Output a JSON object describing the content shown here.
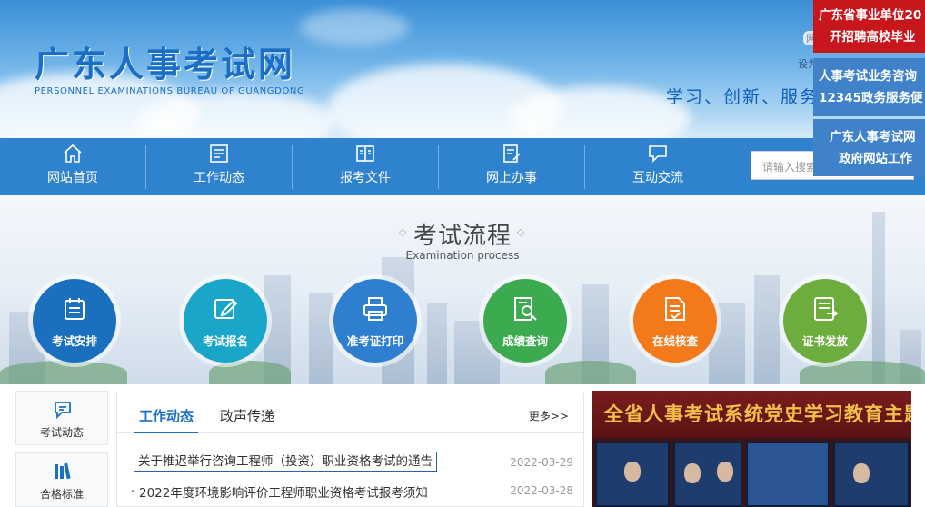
{
  "header": {
    "logo_cn": "广东人事考试网",
    "logo_en": "PERSONNEL EXAMINATIONS BUREAU OF GUANGDONG",
    "slogan": "学习、创新、服务",
    "toplink_a": "网",
    "toplink_b": "设为"
  },
  "nav": {
    "items": [
      {
        "label": "网站首页",
        "icon": "home-icon"
      },
      {
        "label": "工作动态",
        "icon": "news-list-icon"
      },
      {
        "label": "报考文件",
        "icon": "book-icon"
      },
      {
        "label": "网上办事",
        "icon": "form-edit-icon"
      },
      {
        "label": "互动交流",
        "icon": "chat-icon"
      }
    ],
    "search_placeholder": "请输入搜索"
  },
  "floats": {
    "red": [
      "广东省事业单位20",
      "开招聘高校毕业"
    ],
    "blue1": [
      "人事考试业务咨询",
      "12345政务服务便"
    ],
    "blue2": [
      "广东人事考试网",
      "政府网站工作"
    ]
  },
  "process": {
    "title": "考试流程",
    "subtitle": "Examination process",
    "steps": [
      {
        "label": "考试安排",
        "color": "#1b6fbf",
        "icon": "schedule-icon"
      },
      {
        "label": "考试报名",
        "color": "#1aa6c8",
        "icon": "edit-icon"
      },
      {
        "label": "准考证打印",
        "color": "#2f7fd1",
        "icon": "printer-icon"
      },
      {
        "label": "成绩查询",
        "color": "#3cab4f",
        "icon": "search-doc-icon"
      },
      {
        "label": "在线核查",
        "color": "#f27a1a",
        "icon": "verify-doc-icon"
      },
      {
        "label": "证书发放",
        "color": "#6cad3d",
        "icon": "certificate-icon"
      }
    ]
  },
  "side": [
    {
      "label": "考试动态",
      "icon": "chat-bubble-icon"
    },
    {
      "label": "合格标准",
      "icon": "books-icon"
    }
  ],
  "news": {
    "tabs": [
      "工作动态",
      "政声传递"
    ],
    "more": "更多>>",
    "rows": [
      {
        "title": "关于推迟举行咨询工程师（投资）职业资格考试的通告",
        "date": "2022-03-29"
      },
      {
        "title": "2022年度环境影响评价工程师职业资格考试报考须知",
        "date": "2022-03-28"
      }
    ]
  },
  "photo": {
    "caption": "全省人事考试系统党史学习教育主题知识竞赛"
  }
}
